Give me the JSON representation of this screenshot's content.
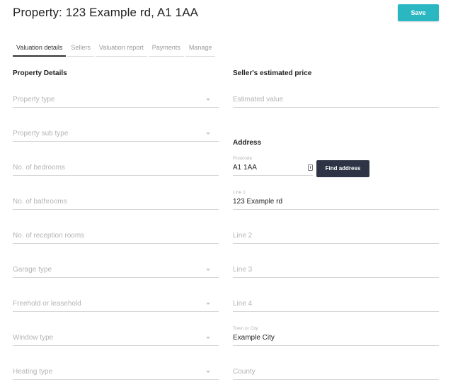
{
  "header": {
    "title": "Property: 123 Example rd, A1 1AA",
    "save_label": "Save"
  },
  "tabs": [
    {
      "label": "Valuation details",
      "active": true
    },
    {
      "label": "Sellers",
      "active": false
    },
    {
      "label": "Valuation report",
      "active": false
    },
    {
      "label": "Payments",
      "active": false
    },
    {
      "label": "Manage",
      "active": false
    }
  ],
  "property_details": {
    "title": "Property Details",
    "fields": [
      {
        "placeholder": "Property type",
        "type": "select"
      },
      {
        "placeholder": "Property sub type",
        "type": "select"
      },
      {
        "placeholder": "No. of bedrooms",
        "type": "input"
      },
      {
        "placeholder": "No. of bathrooms",
        "type": "input"
      },
      {
        "placeholder": "No. of reception rooms",
        "type": "input"
      },
      {
        "placeholder": "Garage type",
        "type": "select"
      },
      {
        "placeholder": "Freehold or leasehold",
        "type": "select"
      },
      {
        "placeholder": "Window type",
        "type": "select"
      },
      {
        "placeholder": "Heating type",
        "type": "select"
      }
    ]
  },
  "estimated_price": {
    "title": "Seller's estimated price",
    "placeholder": "Estimated value"
  },
  "address": {
    "title": "Address",
    "postcode": {
      "label": "Postcode",
      "value": "A1 1AA"
    },
    "find_address_label": "Find address",
    "line1": {
      "label": "Line 1",
      "value": "123 Example rd"
    },
    "line2": {
      "placeholder": "Line 2"
    },
    "line3": {
      "placeholder": "Line 3"
    },
    "line4": {
      "placeholder": "Line 4"
    },
    "town": {
      "label": "Town or City",
      "value": "Example City"
    },
    "county": {
      "placeholder": "County"
    }
  },
  "colors": {
    "accent": "#2bb7c2",
    "dark_button": "#2e3446"
  }
}
